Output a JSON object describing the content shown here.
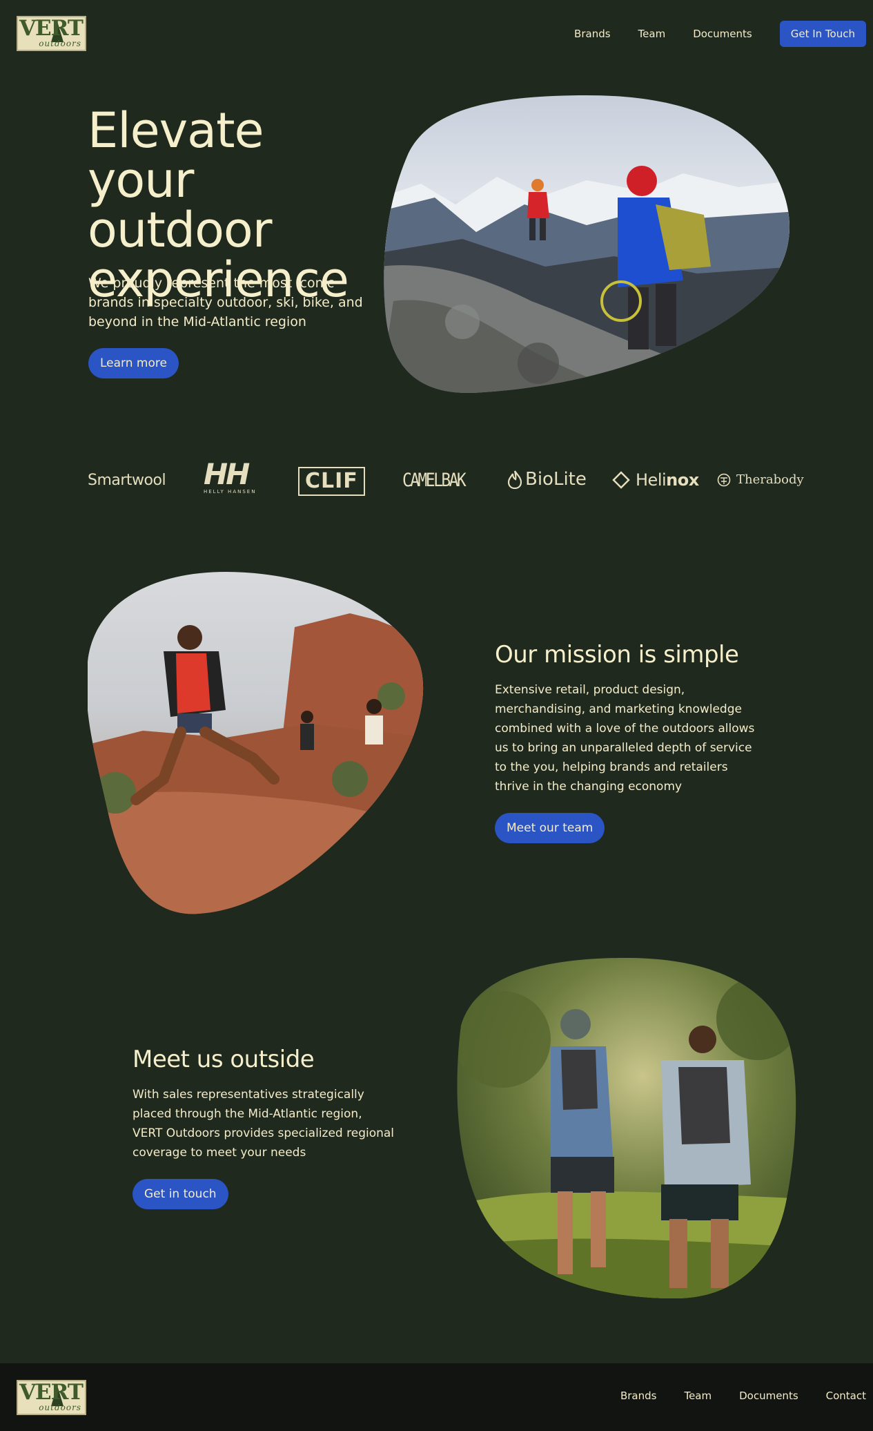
{
  "header": {
    "logo_text": "VERT",
    "logo_sub": "outdoors",
    "nav": [
      "Brands",
      "Team",
      "Documents"
    ],
    "cta": "Get In Touch"
  },
  "hero": {
    "title": "Elevate your outdoor experience",
    "subtitle": "We proudly represent the most iconic brands in specialty outdoor, ski, bike, and beyond in the Mid-Atlantic region",
    "button": "Learn more",
    "image": "mountain-climbers-photo"
  },
  "brands": {
    "smartwool": "Smartwool",
    "hh": "HH",
    "hh_sub": "HELLY HANSEN",
    "clif": "CLIF",
    "camelbak": "CAMELBAK",
    "biolite": "BioLite",
    "helinox_a": "Heli",
    "helinox_b": "nox",
    "therabody": "Therabody"
  },
  "mission": {
    "title": "Our mission is simple",
    "body": "Extensive retail, product design, merchandising, and marketing knowledge combined with a love of the outdoors allows us to bring an unparalleled depth of service to the you, helping brands and retailers thrive in the changing economy",
    "button": "Meet our team",
    "image": "desert-trail-runners-photo"
  },
  "outside": {
    "title": "Meet us outside",
    "body": "With sales representatives strategically placed through the Mid-Atlantic region, VERT Outdoors provides specialized regional coverage to meet your needs",
    "button": "Get in touch",
    "image": "forest-trail-runners-photo"
  },
  "footer": {
    "logo_text": "VERT",
    "logo_sub": "outdoors",
    "nav": [
      "Brands",
      "Team",
      "Documents",
      "Contact"
    ]
  },
  "colors": {
    "background": "#1f291e",
    "footer": "#111410",
    "accent": "#2b55c4",
    "text": "#f4ecc8"
  }
}
